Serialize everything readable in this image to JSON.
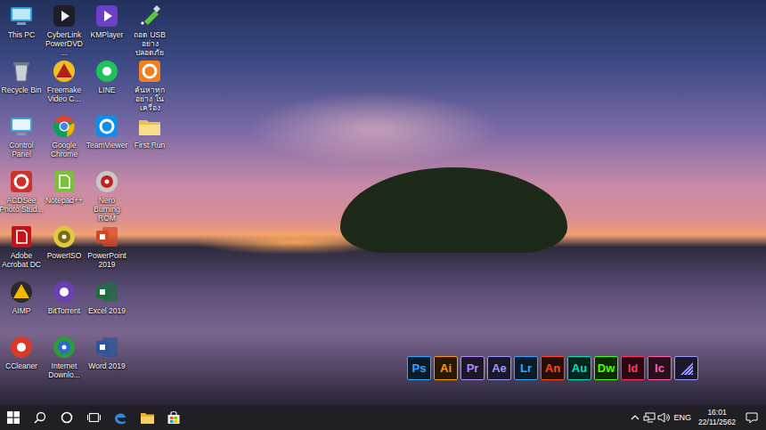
{
  "desktop": {
    "icons": [
      {
        "label": "This PC"
      },
      {
        "label": "Recycle Bin"
      },
      {
        "label": "Control Panel"
      },
      {
        "label": "ACDSee Photo Stud..."
      },
      {
        "label": "Adobe Acrobat DC"
      },
      {
        "label": "AIMP"
      },
      {
        "label": "CCleaner"
      },
      {
        "label": "CyberLink PowerDVD ..."
      },
      {
        "label": "Freemake Video C..."
      },
      {
        "label": "Google Chrome"
      },
      {
        "label": "Notepad++"
      },
      {
        "label": "PowerISO"
      },
      {
        "label": "BitTorrent"
      },
      {
        "label": "Internet Downlo..."
      },
      {
        "label": "KMPlayer"
      },
      {
        "label": "LINE"
      },
      {
        "label": "TeamViewer"
      },
      {
        "label": "Nero Burning ROM"
      },
      {
        "label": "PowerPoint 2019"
      },
      {
        "label": "Excel 2019"
      },
      {
        "label": "Word 2019"
      },
      {
        "label": "ถอด USB อย่าง ปลอดภัย"
      },
      {
        "label": "ค้นหาทุกอย่าง ในเครื่อง"
      },
      {
        "label": "First Run"
      }
    ]
  },
  "dock": {
    "apps": [
      {
        "kind": "letters",
        "label": "Ps",
        "color": "#31a8ff"
      },
      {
        "kind": "letters",
        "label": "Ai",
        "color": "#ff9a00"
      },
      {
        "kind": "letters",
        "label": "Pr",
        "color": "#b08cff"
      },
      {
        "kind": "letters",
        "label": "Ae",
        "color": "#9999ff"
      },
      {
        "kind": "letters",
        "label": "Lr",
        "color": "#31a8ff"
      },
      {
        "kind": "letters",
        "label": "An",
        "color": "#ff4a19"
      },
      {
        "kind": "letters",
        "label": "Au",
        "color": "#00e4bb"
      },
      {
        "kind": "letters",
        "label": "Dw",
        "color": "#4afe00"
      },
      {
        "kind": "letters",
        "label": "Id",
        "color": "#ff3366"
      },
      {
        "kind": "letters",
        "label": "Ic",
        "color": "#ff5fb0"
      },
      {
        "kind": "logo",
        "label": "",
        "color": "#9999ff"
      }
    ]
  },
  "taskbar": {
    "tray": {
      "language": "ENG",
      "time": "16:01",
      "date": "22/11/2562"
    }
  }
}
